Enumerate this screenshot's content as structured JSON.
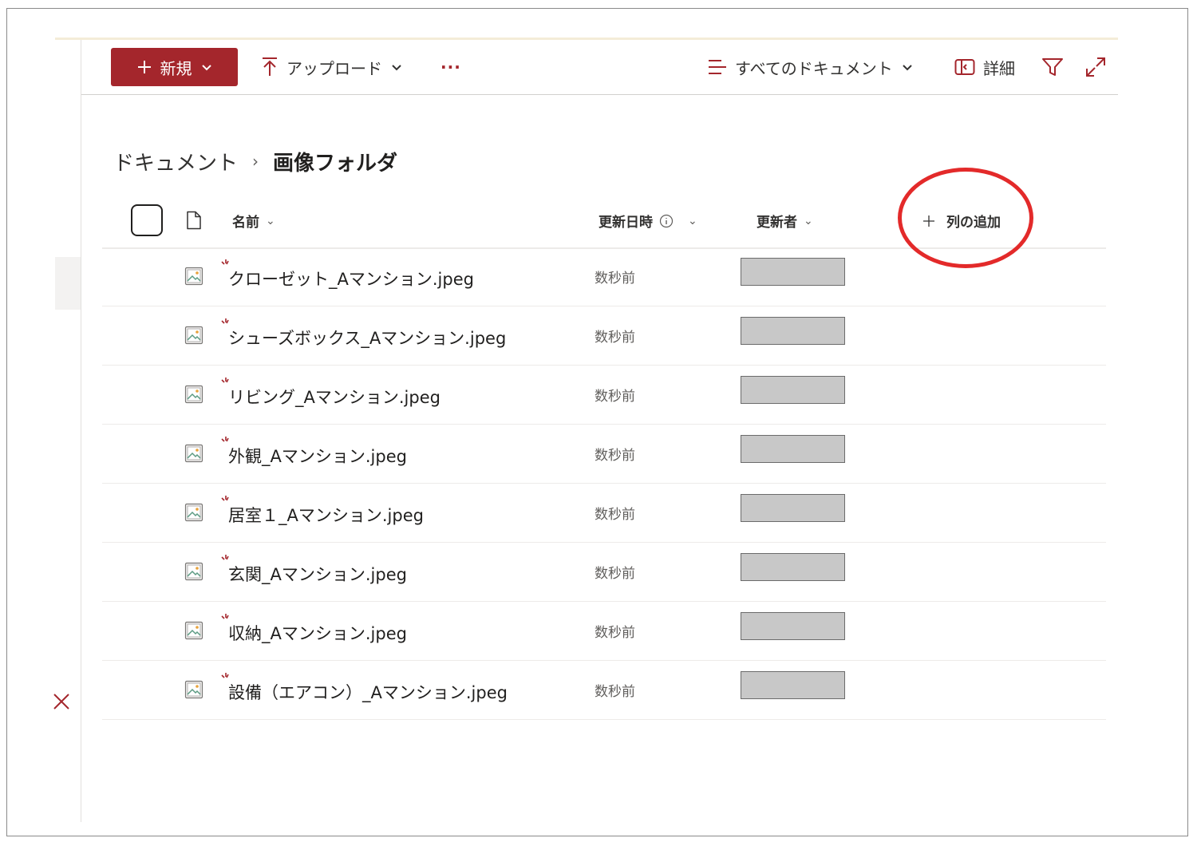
{
  "colors": {
    "accent": "#a4262c",
    "highlight_ring": "#e32a2a"
  },
  "toolbar": {
    "new_label": "新規",
    "upload_label": "アップロード",
    "more_label": "···",
    "view_label": "すべてのドキュメント",
    "details_label": "詳細",
    "icons": [
      "plus-icon",
      "upload-arrow-icon",
      "view-lines-icon",
      "details-pane-icon",
      "filter-icon",
      "expand-icon"
    ]
  },
  "breadcrumb": {
    "root": "ドキュメント",
    "separator": "›",
    "current": "画像フォルダ"
  },
  "columns": {
    "name": "名前",
    "modified": "更新日時",
    "modified_by": "更新者",
    "add_column": "列の追加"
  },
  "files": [
    {
      "name": "クローゼット_Aマンション.jpeg",
      "modified": "数秒前"
    },
    {
      "name": "シューズボックス_Aマンション.jpeg",
      "modified": "数秒前"
    },
    {
      "name": "リビング_Aマンション.jpeg",
      "modified": "数秒前"
    },
    {
      "name": "外観_Aマンション.jpeg",
      "modified": "数秒前"
    },
    {
      "name": "居室１_Aマンション.jpeg",
      "modified": "数秒前"
    },
    {
      "name": "玄関_Aマンション.jpeg",
      "modified": "数秒前"
    },
    {
      "name": "収納_Aマンション.jpeg",
      "modified": "数秒前"
    },
    {
      "name": "設備（エアコン）_Aマンション.jpeg",
      "modified": "数秒前"
    }
  ]
}
